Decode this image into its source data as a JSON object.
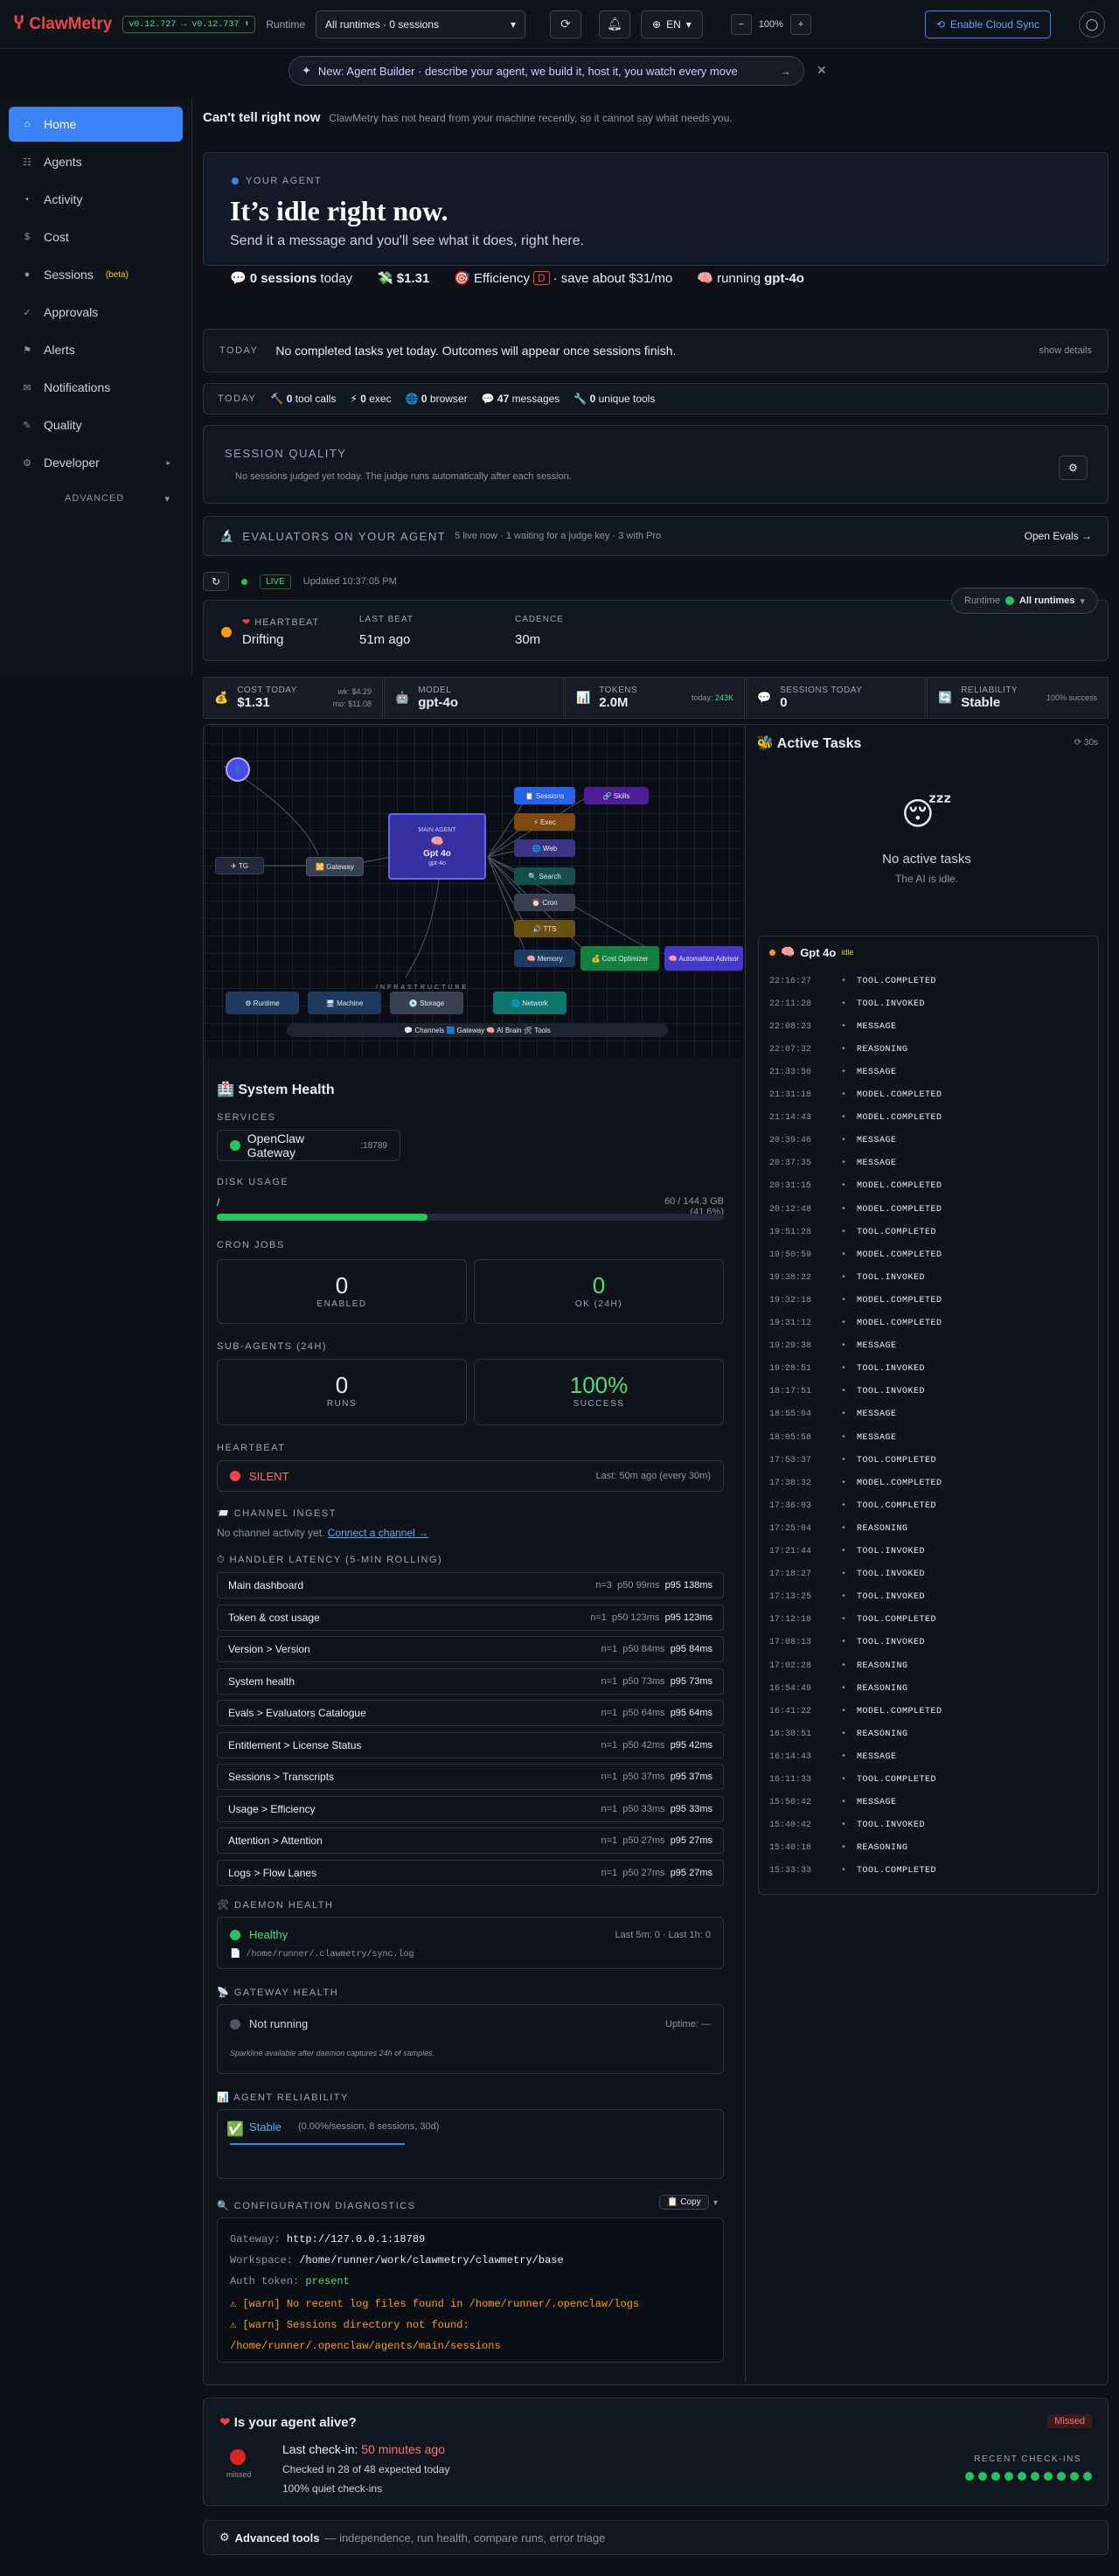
{
  "header": {
    "brand": "ClawMetry",
    "version": "v0.12.727 → v0.12.737 ⬆",
    "runtime_label": "Runtime",
    "runtime_value": "All runtimes · 0 sessions",
    "lang": "EN",
    "zoom": "100%",
    "zoom_minus": "−",
    "zoom_plus": "+",
    "cloud_sync": "Enable Cloud Sync"
  },
  "banner": {
    "text": "New: Agent Builder · describe your agent, we build it, host it, you watch every move",
    "arrow": "→",
    "close": "✕"
  },
  "sidebar": {
    "items": [
      {
        "label": "Home",
        "icon": "⌂"
      },
      {
        "label": "Agents",
        "icon": "☷"
      },
      {
        "label": "Activity",
        "icon": "•"
      },
      {
        "label": "Cost",
        "icon": "$"
      },
      {
        "label": "Sessions",
        "icon": "●",
        "badge": "(beta)"
      },
      {
        "label": "Approvals",
        "icon": "✓"
      },
      {
        "label": "Alerts",
        "icon": "⚑"
      },
      {
        "label": "Notifications",
        "icon": "✉"
      },
      {
        "label": "Quality",
        "icon": "✎"
      },
      {
        "label": "Developer",
        "icon": "⚙",
        "chev": "▸"
      }
    ],
    "advanced": "ADVANCED",
    "advanced_chev": "▾"
  },
  "status": {
    "title": "Can't tell right now",
    "desc": "ClawMetry has not heard from your machine recently, so it cannot say what needs you."
  },
  "hero": {
    "label": "YOUR AGENT",
    "title": "It’s idle right now.",
    "subtitle": "Send it a message and you'll see what it does, right here.",
    "sessions": "0 sessions",
    "sessions_suffix": "today",
    "cost": "$1.31",
    "efficiency_label": "Efficiency",
    "grade": "D",
    "save": "· save about $31/mo",
    "running_label": "running",
    "model": "gpt-4o"
  },
  "today": {
    "label": "TODAY",
    "text": "No completed tasks yet today. Outcomes will appear once sessions finish.",
    "details": "show details"
  },
  "tools": {
    "label": "TODAY",
    "tool_calls": "0",
    "tool_calls_label": "tool calls",
    "exec": "0",
    "exec_label": "exec",
    "browser": "0",
    "browser_label": "browser",
    "messages": "47",
    "messages_label": "messages",
    "unique": "0",
    "unique_label": "unique tools"
  },
  "quality": {
    "title": "SESSION QUALITY",
    "desc": "No sessions judged yet today. The judge runs automatically after each session.",
    "gear": "⚙"
  },
  "evaluators": {
    "title": "EVALUATORS ON YOUR AGENT",
    "desc": "5 live now · 1 waiting for a judge key · 3 with Pro",
    "button": "Open Evals →"
  },
  "live": {
    "refresh": "↻",
    "live": "LIVE",
    "updated": "Updated 10:37:05 PM",
    "runtime_label": "Runtime",
    "runtime_value": "All runtimes",
    "chev": "▾"
  },
  "heartbeat": {
    "label": "HEARTBEAT",
    "state": "Drifting",
    "last_label": "LAST BEAT",
    "last": "51m ago",
    "cadence_label": "CADENCE",
    "cadence": "30m"
  },
  "kpis": {
    "cost_label": "COST TODAY",
    "cost": "$1.31",
    "cost_wk": "wk: $4.29",
    "cost_mo": "mo: $11.08",
    "model_label": "MODEL",
    "model": "gpt-4o",
    "tokens_label": "TOKENS",
    "tokens": "2.0M",
    "tokens_today_label": "today:",
    "tokens_today": "243K",
    "sessions_label": "SESSIONS TODAY",
    "sessions": "0",
    "reliability_label": "RELIABILITY",
    "reliability": "Stable",
    "reliability_pct": "100% success"
  },
  "graph": {
    "core_label": "Gpt 4o",
    "core_sub": "gpt-4o",
    "core_title": "MAIN AGENT",
    "infra": "INFRASTRUCTURE",
    "legend": "💬 Channels  🟦 Gateway  🧠 AI Brain  🛠 Tools",
    "nodes": {
      "tg": "✈ TG",
      "gateway": "🔀 Gateway",
      "sessions": "📋 Sessions",
      "exec": "⚡ Exec",
      "web": "🌐 Web",
      "search": "🔍 Search",
      "cron": "⏰ Cron",
      "tts": "🔊 TTS",
      "memory": "🧠 Memory",
      "skills": "🔗 Skills",
      "cost_opt": "💰 Cost Optimizer",
      "auto": "🧠 Automation Advisor",
      "runtime": "⚙ Runtime",
      "machine": "🖥 Machine",
      "storage": "💿 Storage",
      "network": "🌐 Network"
    }
  },
  "tasks": {
    "title": "Active Tasks",
    "interval": "⟳ 30s",
    "empty": "No active tasks",
    "empty_sub": "The AI is idle.",
    "feed_name": "Gpt 4o",
    "feed_state": "idle",
    "events": [
      [
        "22:16:27",
        "TOOL.COMPLETED"
      ],
      [
        "22:11:28",
        "TOOL.INVOKED"
      ],
      [
        "22:08:23",
        "MESSAGE"
      ],
      [
        "22:07:32",
        "REASONING"
      ],
      [
        "21:33:50",
        "MESSAGE"
      ],
      [
        "21:31:18",
        "MODEL.COMPLETED"
      ],
      [
        "21:14:43",
        "MODEL.COMPLETED"
      ],
      [
        "20:39:46",
        "MESSAGE"
      ],
      [
        "20:37:35",
        "MESSAGE"
      ],
      [
        "20:31:15",
        "MODEL.COMPLETED"
      ],
      [
        "20:12:48",
        "MODEL.COMPLETED"
      ],
      [
        "19:51:28",
        "TOOL.COMPLETED"
      ],
      [
        "19:50:59",
        "MODEL.COMPLETED"
      ],
      [
        "19:38:22",
        "TOOL.INVOKED"
      ],
      [
        "19:32:18",
        "MODEL.COMPLETED"
      ],
      [
        "19:31:12",
        "MODEL.COMPLETED"
      ],
      [
        "19:29:38",
        "MESSAGE"
      ],
      [
        "19:28:51",
        "TOOL.INVOKED"
      ],
      [
        "18:17:51",
        "TOOL.INVOKED"
      ],
      [
        "18:55:04",
        "MESSAGE"
      ],
      [
        "18:05:58",
        "MESSAGE"
      ],
      [
        "17:53:37",
        "TOOL.COMPLETED"
      ],
      [
        "17:38:32",
        "MODEL.COMPLETED"
      ],
      [
        "17:36:03",
        "TOOL.COMPLETED"
      ],
      [
        "17:25:04",
        "REASONING"
      ],
      [
        "17:21:44",
        "TOOL.INVOKED"
      ],
      [
        "17:18:27",
        "TOOL.INVOKED"
      ],
      [
        "17:13:25",
        "TOOL.INVOKED"
      ],
      [
        "17:12:18",
        "TOOL.COMPLETED"
      ],
      [
        "17:08:13",
        "TOOL.INVOKED"
      ],
      [
        "17:02:28",
        "REASONING"
      ],
      [
        "16:54:49",
        "REASONING"
      ],
      [
        "16:41:22",
        "MODEL.COMPLETED"
      ],
      [
        "16:30:51",
        "REASONING"
      ],
      [
        "16:14:43",
        "MESSAGE"
      ],
      [
        "16:11:33",
        "TOOL.COMPLETED"
      ],
      [
        "15:50:42",
        "MESSAGE"
      ],
      [
        "15:40:42",
        "TOOL.INVOKED"
      ],
      [
        "15:40:18",
        "REASONING"
      ],
      [
        "15:33:33",
        "TOOL.COMPLETED"
      ]
    ]
  },
  "health": {
    "title": "System Health",
    "services_label": "SERVICES",
    "gateway": "OpenClaw Gateway",
    "gateway_port": ":18789",
    "disk_label": "DISK USAGE",
    "disk_path": "/",
    "disk_value": "60 / 144.3 GB (41.6%)",
    "disk_pct": 41.6,
    "cron_label": "CRON JOBS",
    "cron_enabled": "0",
    "cron_enabled_label": "ENABLED",
    "cron_ok": "0",
    "cron_ok_label": "OK (24H)",
    "sub_label": "SUB-AGENTS (24H)",
    "sub_runs": "0",
    "sub_runs_label": "RUNS",
    "sub_success": "100%",
    "sub_success_label": "SUCCESS",
    "hb_label": "HEARTBEAT",
    "hb_state": "SILENT",
    "hb_last": "Last: 50m ago (every 30m)",
    "ingest_label": "CHANNEL INGEST",
    "ingest_text": "No channel activity yet.",
    "ingest_link": "Connect a channel →",
    "latency_label": "HANDLER LATENCY (5-MIN ROLLING)",
    "latency": [
      [
        "Main dashboard",
        "n=3",
        "p50 99ms",
        "p95 138ms"
      ],
      [
        "Token & cost usage",
        "n=1",
        "p50 123ms",
        "p95 123ms"
      ],
      [
        "Version > Version",
        "n=1",
        "p50 84ms",
        "p95 84ms"
      ],
      [
        "System health",
        "n=1",
        "p50 73ms",
        "p95 73ms"
      ],
      [
        "Evals > Evaluators Catalogue",
        "n=1",
        "p50 64ms",
        "p95 64ms"
      ],
      [
        "Entitlement > License Status",
        "n=1",
        "p50 42ms",
        "p95 42ms"
      ],
      [
        "Sessions > Transcripts",
        "n=1",
        "p50 37ms",
        "p95 37ms"
      ],
      [
        "Usage > Efficiency",
        "n=1",
        "p50 33ms",
        "p95 33ms"
      ],
      [
        "Attention > Attention",
        "n=1",
        "p50 27ms",
        "p95 27ms"
      ],
      [
        "Logs > Flow Lanes",
        "n=1",
        "p50 27ms",
        "p95 27ms"
      ]
    ],
    "daemon_label": "DAEMON HEALTH",
    "daemon_state": "Healthy",
    "daemon_stats": "Last 5m: 0 · Last 1h: 0",
    "daemon_path": "/home/runner/.clawmetry/sync.log",
    "gw_label": "GATEWAY HEALTH",
    "gw_state": "Not running",
    "gw_uptime": "Uptime: —",
    "gw_note": "Sparkline available after daemon captures 24h of samples.",
    "rel_label": "AGENT RELIABILITY",
    "rel_state": "Stable",
    "rel_desc": "(0.00%/session, 8 sessions, 30d)",
    "diag_label": "CONFIGURATION DIAGNOSTICS",
    "diag_copy": "📋 Copy",
    "diag_chev": "▾",
    "diag": {
      "gw_k": "Gateway:",
      "gw_v": "http://127.0.0.1:18789",
      "ws_k": "Workspace:",
      "ws_v": "/home/runner/work/clawmetry/clawmetry/base",
      "auth_k": "Auth token:",
      "auth_v": "present",
      "warn1": "⚠ [warn] No recent log files found in /home/runner/.openclaw/logs",
      "warn2a": "⚠ [warn] Sessions directory not found:",
      "warn2b": "/home/runner/.openclaw/agents/main/sessions"
    }
  },
  "alive": {
    "title": "Is your agent alive?",
    "badge": "Missed",
    "missed": "missed",
    "checkin_label": "Last check-in:",
    "checkin": "50 minutes ago",
    "checked": "Checked in 28 of 48 expected today",
    "quiet": "100% quiet check-ins",
    "recent": "RECENT CHECK-INS"
  },
  "advanced": {
    "title": "Advanced tools",
    "desc": "— independence, run health, compare runs, error triage"
  },
  "colors": {
    "accent": "#3b82f6",
    "green": "#4ade80",
    "red": "#ef4444",
    "yellow": "#facc15"
  }
}
